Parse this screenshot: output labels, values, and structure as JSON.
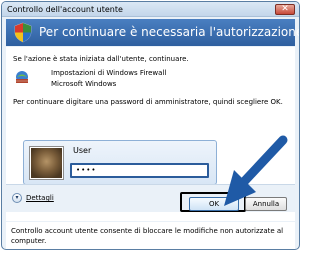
{
  "window": {
    "title": "Controllo dell'account utente",
    "close_glyph": "✕"
  },
  "banner": {
    "text": "Per continuare è necessaria l'autorizzazione dell'utente"
  },
  "content": {
    "intro": "Se l'azione è stata iniziata dall'utente, continuare.",
    "program_name": "Impostazioni di Windows Firewall",
    "program_publisher": "Microsoft Windows",
    "instruction": "Per continuare digitare una password di amministratore, quindi scegliere OK."
  },
  "credentials": {
    "user_label": "User",
    "password_value": "••••"
  },
  "buttons": {
    "details_label": "Dettagli",
    "ok_label": "OK",
    "cancel_label": "Annulla"
  },
  "footer": {
    "text": "Controllo account utente consente di bloccare le modifiche non autorizzate al computer."
  },
  "colors": {
    "banner": "#3d6eb0",
    "arrow": "#1f5aa6"
  }
}
